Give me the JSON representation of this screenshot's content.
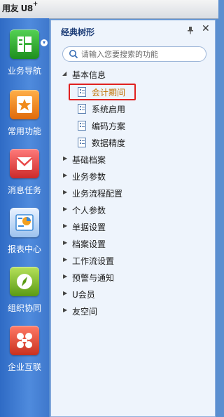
{
  "app": {
    "brand": "用友 U8",
    "brand_sup": "+"
  },
  "sidebar": {
    "items": [
      {
        "label": "业务导航",
        "icon": "business-navigation-icon",
        "color": "#2aa52a"
      },
      {
        "label": "常用功能",
        "icon": "star-icon",
        "color": "#f08a1c"
      },
      {
        "label": "消息任务",
        "icon": "message-icon",
        "color": "#e84848"
      },
      {
        "label": "报表中心",
        "icon": "report-icon",
        "color": "#3c8ad8"
      },
      {
        "label": "组织协同",
        "icon": "compass-icon",
        "color": "#7cbb2a"
      },
      {
        "label": "企业互联",
        "icon": "enterprise-connect-icon",
        "color": "#e04a3a"
      }
    ]
  },
  "panel": {
    "title": "经典树形",
    "search_placeholder": "请输入您要搜索的功能",
    "tree": {
      "root": {
        "label": "基本信息",
        "expanded": true,
        "children": [
          "会计期间",
          "系统启用",
          "编码方案",
          "数据精度"
        ],
        "highlighted_child": "会计期间"
      },
      "others": [
        "基础档案",
        "业务参数",
        "业务流程配置",
        "个人参数",
        "单据设置",
        "档案设置",
        "工作流设置",
        "预警与通知",
        "U会员",
        "友空间"
      ]
    }
  },
  "colors": {
    "highlight_border": "#e02020",
    "highlight_text": "#c07000",
    "panel_bg": "#eef4fc"
  }
}
